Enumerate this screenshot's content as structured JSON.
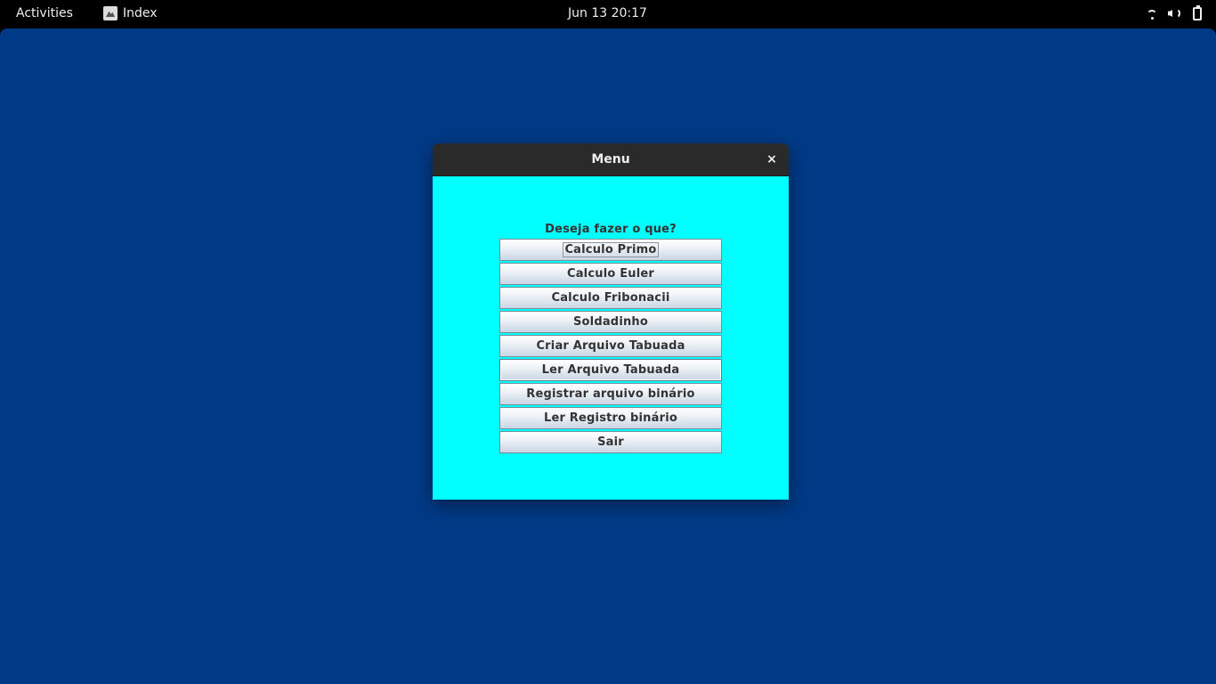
{
  "topbar": {
    "activities": "Activities",
    "app_name": "Index",
    "clock": "Jun 13  20:17",
    "icons": [
      "wifi-icon",
      "volume-icon",
      "battery-icon"
    ]
  },
  "window": {
    "title": "Menu",
    "close_glyph": "×",
    "prompt": "Deseja fazer o que?",
    "buttons": [
      "Calculo Primo",
      "Calculo Euler",
      "Calculo Fribonacii",
      "Soldadinho",
      "Criar Arquivo Tabuada",
      "Ler Arquivo Tabuada",
      "Registrar arquivo binário",
      "Ler Registro binário",
      "Sair"
    ]
  },
  "colors": {
    "desktop_bg": "#003a86",
    "content_bg": "#00ffff",
    "titlebar_bg": "#2a2a2a"
  }
}
